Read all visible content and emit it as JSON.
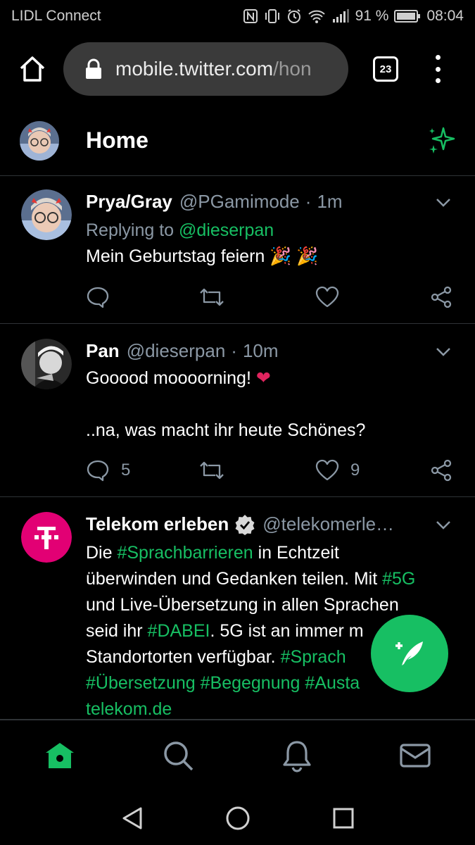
{
  "status_bar": {
    "carrier": "LIDL Connect",
    "battery": "91 %",
    "time": "08:04"
  },
  "browser": {
    "url_main": "mobile.twitter.com",
    "url_rest": "/hon",
    "tab_count": "23"
  },
  "header": {
    "title": "Home"
  },
  "tweets": [
    {
      "name": "Prya/Gray",
      "handle": "@PGamimode",
      "time": "1m",
      "replying_prefix": "Replying to",
      "replying_handle": "@dieserpan",
      "text": "Mein Geburtstag feiern 🎉 🎉",
      "reply_count": "",
      "like_count": ""
    },
    {
      "name": "Pan",
      "handle": "@dieserpan",
      "time": "10m",
      "text_line1": "Gooood moooorning! ❤",
      "text_line2": "..na, was macht ihr heute Schönes?",
      "reply_count": "5",
      "like_count": "9"
    },
    {
      "name": "Telekom erleben",
      "handle": "@telekomerle…",
      "text_parts": {
        "t1": "Die ",
        "h1": "#Sprachbarrieren",
        "t2": " in Echtzeit",
        "t3": "überwinden und Gedanken teilen. Mit ",
        "h2": "#5G",
        "t4": " und Live-Übersetzung in allen Sprachen",
        "t5": "seid ihr ",
        "h3": "#DABEI",
        "t6": ". 5G ist an immer m",
        "t7": "Standortorten verfügbar. ",
        "h4": "#Sprach",
        "h5": "#Übersetzung",
        "h6": "#Begegnung",
        "h7": "#Austa",
        "h7b": "n",
        "link": "telekom.de"
      }
    }
  ],
  "colors": {
    "accent": "#17bf63",
    "muted": "#8b98a5",
    "telekom": "#e20074",
    "heart": "#e0245e"
  },
  "icons": {
    "home": "home-icon",
    "search": "search-icon",
    "notifications": "bell-icon",
    "messages": "mail-icon",
    "compose": "compose-feather-icon"
  }
}
